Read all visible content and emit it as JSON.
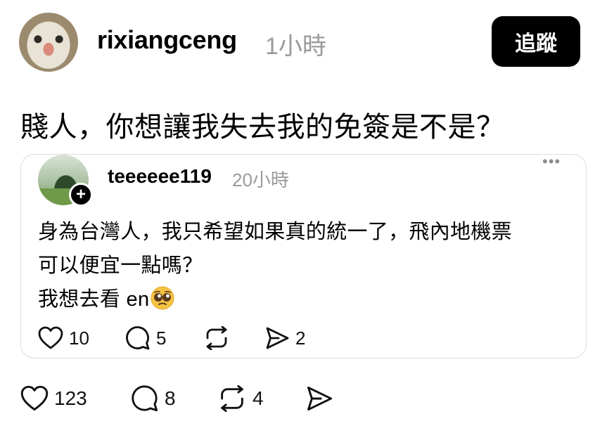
{
  "post": {
    "username": "rixiangceng",
    "timestamp": "1小時",
    "follow_label": "追蹤",
    "text": "賤人，你想讓我失去我的免簽是不是？",
    "actions": {
      "likes": "123",
      "comments": "8",
      "reposts": "4"
    }
  },
  "quoted": {
    "username": "teeeeee119",
    "timestamp": "20小時",
    "plus": "+",
    "more": "•••",
    "lines": [
      "身為台灣人，我只希望如果真的統一了，飛內地機票",
      "可以便宜一點嗎？",
      "我想去看 en"
    ],
    "emoji": "pleading-face-emoji",
    "actions": {
      "likes": "10",
      "comments": "5",
      "shares": "2"
    }
  },
  "icons": [
    "heart-icon",
    "comment-icon",
    "repost-icon",
    "share-icon",
    "more-icon",
    "plus-icon"
  ]
}
